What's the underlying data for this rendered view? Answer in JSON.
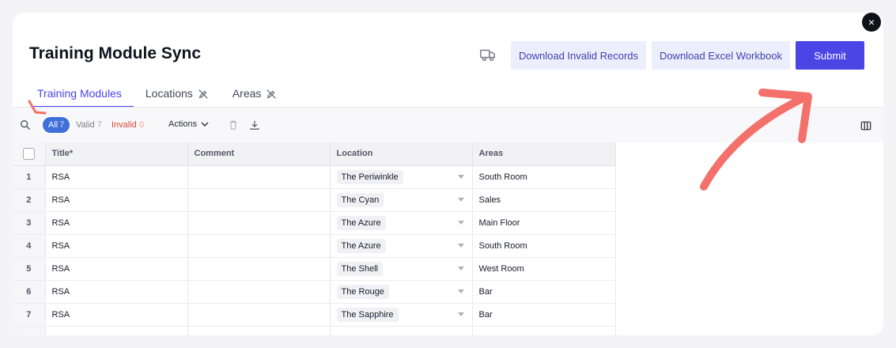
{
  "header": {
    "title": "Training Module Sync",
    "buttons": {
      "download_invalid": "Download Invalid Records",
      "download_excel": "Download Excel Workbook",
      "submit": "Submit"
    },
    "close_symbol": "×"
  },
  "tabs": [
    {
      "label": "Training Modules",
      "active": true
    },
    {
      "label": "Locations",
      "icon": "no-edit-pencil-icon"
    },
    {
      "label": "Areas",
      "icon": "no-edit-pencil-icon"
    }
  ],
  "toolbar": {
    "all_label": "All",
    "all_count": "7",
    "valid_label": "Valid",
    "valid_count": "7",
    "invalid_label": "Invalid",
    "invalid_count": "0",
    "actions_label": "Actions"
  },
  "table": {
    "columns": [
      "Title*",
      "Comment",
      "Location",
      "Areas"
    ],
    "rows": [
      {
        "num": "1",
        "title": "RSA",
        "comment": "",
        "location": "The Periwinkle",
        "areas": "South Room"
      },
      {
        "num": "2",
        "title": "RSA",
        "comment": "",
        "location": "The Cyan",
        "areas": "Sales"
      },
      {
        "num": "3",
        "title": "RSA",
        "comment": "",
        "location": "The Azure",
        "areas": "Main Floor"
      },
      {
        "num": "4",
        "title": "RSA",
        "comment": "",
        "location": "The Azure",
        "areas": "South Room"
      },
      {
        "num": "5",
        "title": "RSA",
        "comment": "",
        "location": "The Shell",
        "areas": "West Room"
      },
      {
        "num": "6",
        "title": "RSA",
        "comment": "",
        "location": "The Rouge",
        "areas": "Bar"
      },
      {
        "num": "7",
        "title": "RSA",
        "comment": "",
        "location": "The Sapphire",
        "areas": "Bar"
      }
    ]
  },
  "colors": {
    "accent": "#4b45e6",
    "annotation_arrow": "#f4706a",
    "all_pill": "#3f6fd9",
    "invalid_text": "#d14a3a"
  }
}
